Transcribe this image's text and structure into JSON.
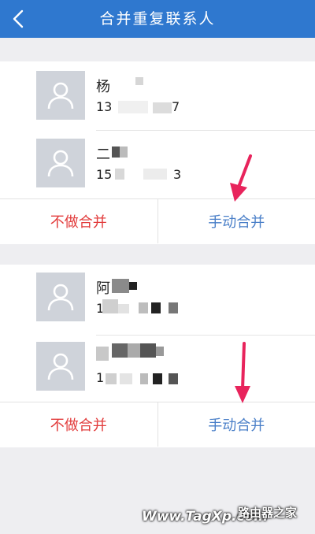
{
  "header": {
    "title": "合并重复联系人",
    "back_icon": "chevron-left-icon"
  },
  "groups": [
    {
      "contacts": [
        {
          "name": "杨",
          "phone": "13",
          "phone_tail": "7"
        },
        {
          "name": "二",
          "phone": "15",
          "phone_tail": "3"
        }
      ],
      "actions": {
        "no_merge": "不做合并",
        "manual_merge": "手动合并"
      }
    },
    {
      "contacts": [
        {
          "name": "阿",
          "phone": "1",
          "phone_tail": ""
        },
        {
          "name": "",
          "phone": "1",
          "phone_tail": ""
        }
      ],
      "actions": {
        "no_merge": "不做合并",
        "manual_merge": "手动合并"
      }
    }
  ],
  "watermark": {
    "site": "Www.TagXp.com",
    "brand": "路由器之家"
  },
  "colors": {
    "header": "#2f78cf",
    "no_merge": "#e23c3c",
    "manual_merge": "#4a7fc8",
    "arrow": "#e8245c",
    "avatar": "#cfd3da"
  }
}
